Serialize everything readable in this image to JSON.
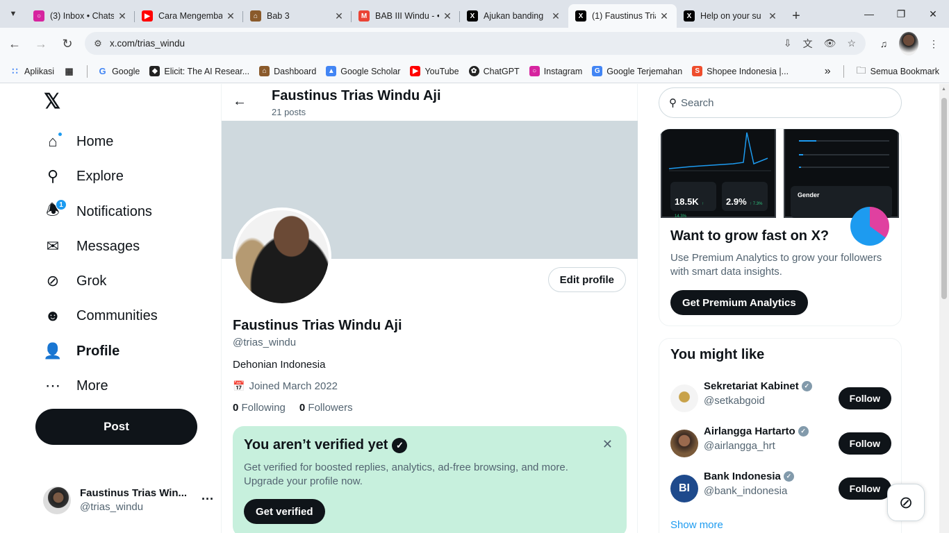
{
  "browser": {
    "tabs": [
      {
        "title": "(3) Inbox • Chats",
        "icon": "instagram-icon",
        "color": "#d6249f"
      },
      {
        "title": "Cara Mengemba",
        "icon": "youtube-icon",
        "color": "#ff0000"
      },
      {
        "title": "Bab 3",
        "icon": "dashboard-icon",
        "color": "#8a5a2b"
      },
      {
        "title": "BAB III Windu - •",
        "icon": "gmail-icon",
        "color": "#ea4335"
      },
      {
        "title": "Ajukan banding",
        "icon": "x-icon",
        "color": "#000000"
      },
      {
        "title": "(1) Faustinus Tria",
        "icon": "x-icon",
        "color": "#000000"
      },
      {
        "title": "Help on your su",
        "icon": "x-icon",
        "color": "#000000"
      }
    ],
    "url": "x.com/trias_windu",
    "bookmarks": [
      {
        "label": "Aplikasi",
        "icon": "apps-grid-icon",
        "color": "#4285f4"
      },
      {
        "label": "Google",
        "icon": "google-icon",
        "color": "#4285f4"
      },
      {
        "label": "Elicit: The AI Resear...",
        "icon": "elicit-icon",
        "color": "#222222"
      },
      {
        "label": "Dashboard",
        "icon": "dashboard-icon",
        "color": "#8a5a2b"
      },
      {
        "label": "Google Scholar",
        "icon": "scholar-icon",
        "color": "#4285f4"
      },
      {
        "label": "YouTube",
        "icon": "youtube-icon",
        "color": "#ff0000"
      },
      {
        "label": "ChatGPT",
        "icon": "chatgpt-icon",
        "color": "#222222"
      },
      {
        "label": "Instagram",
        "icon": "instagram-icon",
        "color": "#d6249f"
      },
      {
        "label": "Google Terjemahan",
        "icon": "translate-icon",
        "color": "#4285f4"
      },
      {
        "label": "Shopee Indonesia |...",
        "icon": "shopee-icon",
        "color": "#ee4d2d"
      }
    ],
    "all_bookmarks": "Semua Bookmark"
  },
  "nav": {
    "items": [
      {
        "label": "Home",
        "icon": "home-icon"
      },
      {
        "label": "Explore",
        "icon": "search-icon"
      },
      {
        "label": "Notifications",
        "icon": "bell-icon",
        "badge": "1"
      },
      {
        "label": "Messages",
        "icon": "mail-icon"
      },
      {
        "label": "Grok",
        "icon": "grok-icon"
      },
      {
        "label": "Communities",
        "icon": "communities-icon"
      },
      {
        "label": "Profile",
        "icon": "person-icon"
      },
      {
        "label": "More",
        "icon": "more-icon"
      }
    ],
    "post": "Post",
    "account_name": "Faustinus Trias Win...",
    "account_handle": "@trias_windu"
  },
  "profile": {
    "header_name": "Faustinus Trias Windu Aji",
    "posts": "21 posts",
    "edit": "Edit profile",
    "name": "Faustinus Trias Windu Aji",
    "handle": "@trias_windu",
    "bio": "Dehonian Indonesia",
    "joined": "Joined March 2022",
    "following_count": "0",
    "following_label": "Following",
    "followers_count": "0",
    "followers_label": "Followers"
  },
  "verify": {
    "title": "You aren’t verified yet",
    "desc": "Get verified for boosted replies, analytics, ad-free browsing, and more. Upgrade your profile now.",
    "button": "Get verified"
  },
  "sidebar": {
    "search_placeholder": "Search",
    "promo": {
      "stat1": "18.5K",
      "stat1_delta": "↑ 14.3%",
      "stat2": "2.9%",
      "stat2_delta": "↑ 7.3%",
      "gender": "Gender",
      "title": "Want to grow fast on X?",
      "desc": "Use Premium Analytics to grow your followers with smart data insights.",
      "button": "Get Premium Analytics"
    },
    "wtf": {
      "title": "You might like",
      "accounts": [
        {
          "name": "Sekretariat Kabinet",
          "handle": "@setkabgoid",
          "button": "Follow"
        },
        {
          "name": "Airlangga Hartarto",
          "handle": "@airlangga_hrt",
          "button": "Follow"
        },
        {
          "name": "Bank Indonesia",
          "handle": "@bank_indonesia",
          "button": "Follow"
        }
      ],
      "show_more": "Show more"
    }
  }
}
